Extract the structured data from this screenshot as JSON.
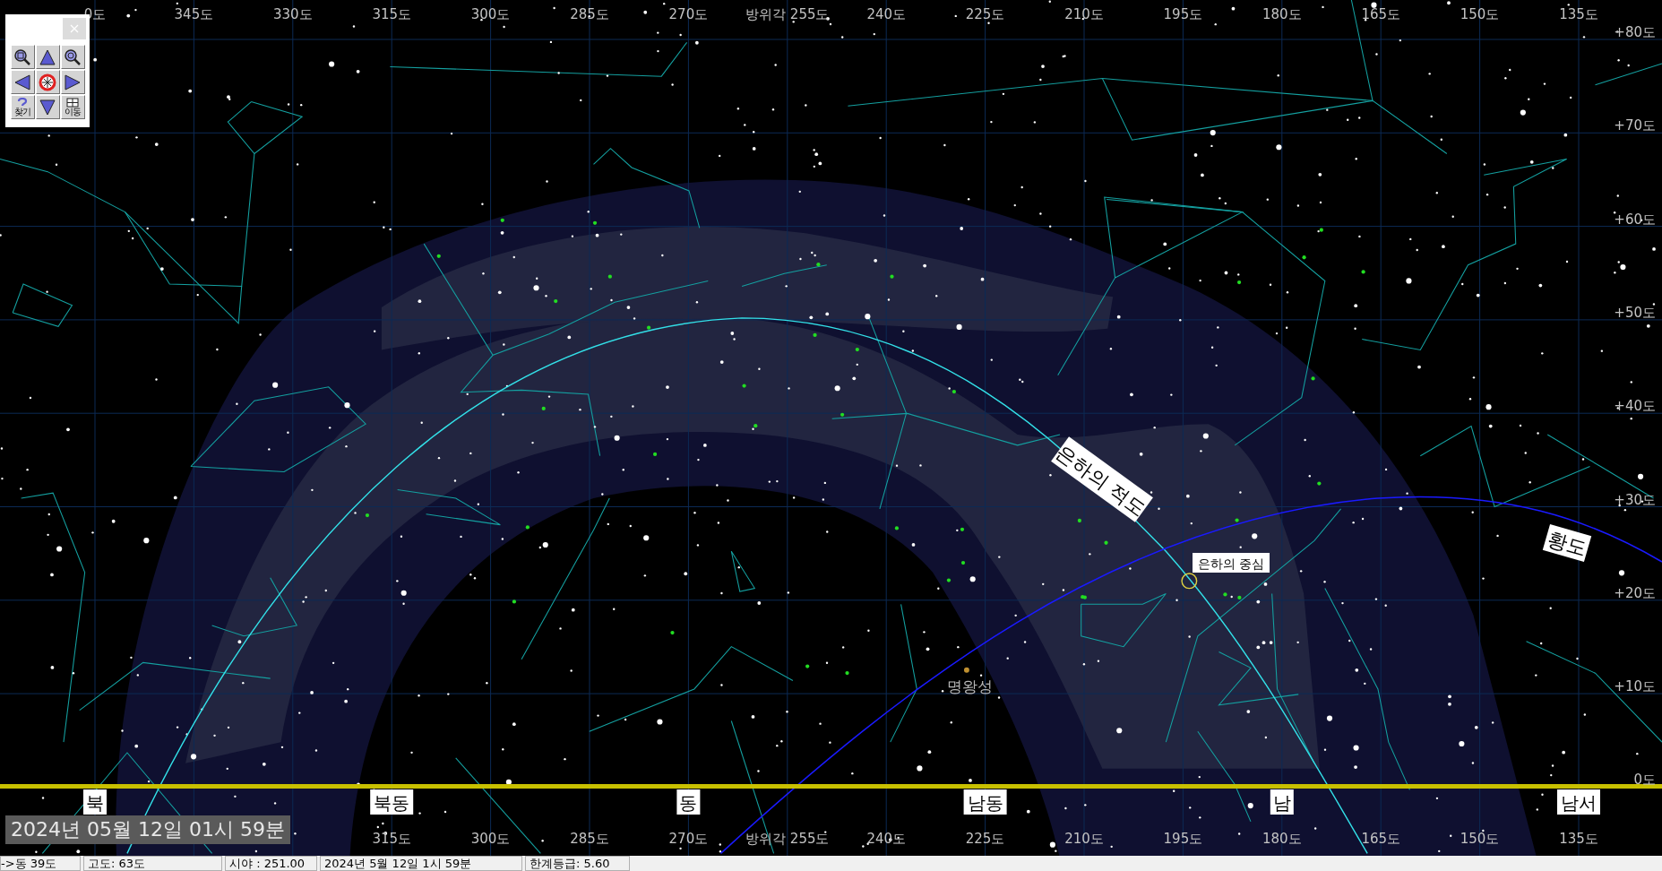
{
  "toolbar": {
    "buttons": [
      {
        "kind": "zoom-in"
      },
      {
        "kind": "up"
      },
      {
        "kind": "zoom-out"
      },
      {
        "kind": "left"
      },
      {
        "kind": "center"
      },
      {
        "kind": "right"
      },
      {
        "kind": "find",
        "label": "찾기"
      },
      {
        "kind": "down"
      },
      {
        "kind": "move",
        "label": "이동"
      }
    ]
  },
  "top_axis": [
    "0도",
    "345도",
    "330도",
    "315도",
    "300도",
    "285도",
    "270도",
    "방위각 255도",
    "240도",
    "225도",
    "210도",
    "195도",
    "180도",
    "165도",
    "150도",
    "135도"
  ],
  "right_axis": [
    "+80도",
    "+70도",
    "+60도",
    "+50도",
    "+40도",
    "+30도",
    "+20도",
    "+10도",
    "0도"
  ],
  "directions": [
    "북",
    "북동",
    "동",
    "남동",
    "남",
    "남서"
  ],
  "bottom_axis": [
    "315도",
    "300도",
    "285도",
    "270도",
    "방위각 255도",
    "240도",
    "225도",
    "210도",
    "195도",
    "180도",
    "165도",
    "150도",
    "135도"
  ],
  "chart_labels": {
    "galactic_equator": "은하의 적도",
    "galactic_center": "은하의 중심",
    "ecliptic": "황도",
    "pluto": "명왕성"
  },
  "date_overlay": "2024년 05월 12일 01시 59분",
  "status_bar": [
    "->동  39도",
    "고도:   63도",
    "시야 : 251.00",
    "2024년  5월 12일  1시 59분",
    "한계등급:  5.60"
  ]
}
